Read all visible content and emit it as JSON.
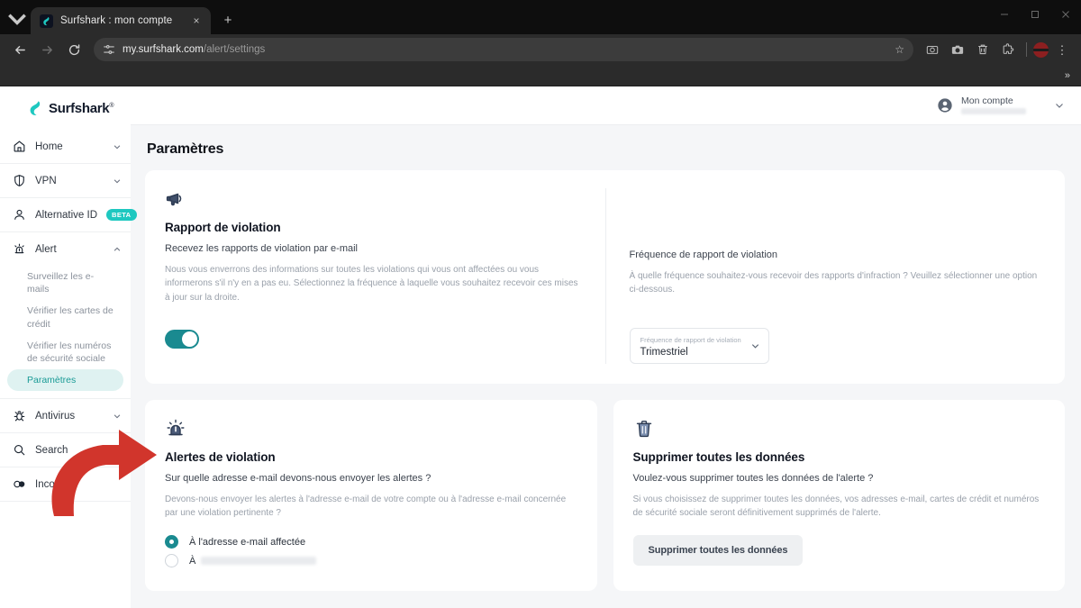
{
  "browser": {
    "tab": {
      "title": "Surfshark : mon compte",
      "favicon": "surfshark-favicon",
      "close": "×"
    },
    "new_tab": "+",
    "tab_list_icon": "chevron-down-icon",
    "nav": {
      "back": "back-arrow-icon",
      "forward": "forward-arrow-icon",
      "reload": "reload-icon"
    },
    "omnibox": {
      "site_settings_icon": "tune-icon",
      "url_host": "my.surfshark.com",
      "url_path": "/alert/settings",
      "bookmark_icon": "star-icon"
    },
    "toolbar_icons": [
      "screenshot-icon",
      "camera-icon",
      "trash-icon",
      "extensions-icon"
    ],
    "profile_avatar": "profile-avatar",
    "menu_icon": "kebab-menu-icon",
    "bookmarks_overflow": "»",
    "window_controls": {
      "minimize": "minimize-icon",
      "maximize": "maximize-icon",
      "close": "close-icon"
    }
  },
  "sidebar": {
    "brand": {
      "name": "Surfshark",
      "trademark": "®"
    },
    "items": [
      {
        "label": "Home",
        "icon": "home-icon",
        "chevron": "chevron-down-icon"
      },
      {
        "label": "VPN",
        "icon": "shield-icon",
        "chevron": "chevron-down-icon"
      },
      {
        "label": "Alternative ID",
        "icon": "person-icon",
        "badge": "BETA"
      },
      {
        "label": "Alert",
        "icon": "alert-siren-icon",
        "chevron": "chevron-up-icon"
      },
      {
        "label": "Antivirus",
        "icon": "antivirus-bug-icon",
        "chevron": "chevron-down-icon"
      },
      {
        "label": "Search",
        "icon": "search-icon"
      },
      {
        "label": "Incogni",
        "icon": "incogni-icon"
      }
    ],
    "alert_subitems": [
      {
        "label": "Surveillez les e-mails",
        "active": false
      },
      {
        "label": "Vérifier les cartes de crédit",
        "active": false
      },
      {
        "label": "Vérifier les numéros de sécurité sociale",
        "active": false
      },
      {
        "label": "Paramètres",
        "active": true
      }
    ]
  },
  "topbar": {
    "account_label": "Mon compte",
    "account_icon": "account-circle-icon",
    "chevron": "chevron-down-icon"
  },
  "main": {
    "page_title": "Paramètres",
    "breach_report": {
      "icon": "megaphone-icon",
      "title": "Rapport de violation",
      "subtitle": "Recevez les rapports de violation par e-mail",
      "body": "Nous vous enverrons des informations sur toutes les violations qui vous ont affectées ou vous informerons s'il n'y en a pas eu. Sélectionnez la fréquence à laquelle vous souhaitez recevoir ces mises à jour sur la droite.",
      "toggle_on": true
    },
    "breach_frequency": {
      "title": "Fréquence de rapport de violation",
      "body": "À quelle fréquence souhaitez-vous recevoir des rapports d'infraction ? Veuillez sélectionner une option ci-dessous.",
      "select_label": "Fréquence de rapport de violation",
      "select_value": "Trimestriel",
      "chevron": "chevron-down-icon"
    },
    "breach_alerts": {
      "icon": "siren-icon",
      "title": "Alertes de violation",
      "subtitle": "Sur quelle adresse e-mail devons-nous envoyer les alertes ?",
      "body": "Devons-nous envoyer les alertes à l'adresse e-mail de votre compte ou à l'adresse e-mail concernée par une violation pertinente ?",
      "options": [
        {
          "label": "À l'adresse e-mail affectée",
          "selected": true
        },
        {
          "label": "À",
          "selected": false,
          "redacted_email": true
        }
      ]
    },
    "delete_data": {
      "icon": "trash-bin-icon",
      "title": "Supprimer toutes les données",
      "subtitle": "Voulez-vous supprimer toutes les données de l'alerte ?",
      "body": "Si vous choisissez de supprimer toutes les données, vos adresses e-mail, cartes de crédit et numéros de sécurité sociale seront définitivement supprimés de l'alerte.",
      "button_label": "Supprimer toutes les données"
    }
  },
  "annotation": {
    "arrow": "red-curved-arrow",
    "color": "#d1352c"
  },
  "colors": {
    "accent_teal": "#1a8a90",
    "badge_teal": "#1ec8c0",
    "pill_bg": "#dff2f1",
    "page_bg": "#f5f6f8",
    "annotation_red": "#d1352c"
  }
}
